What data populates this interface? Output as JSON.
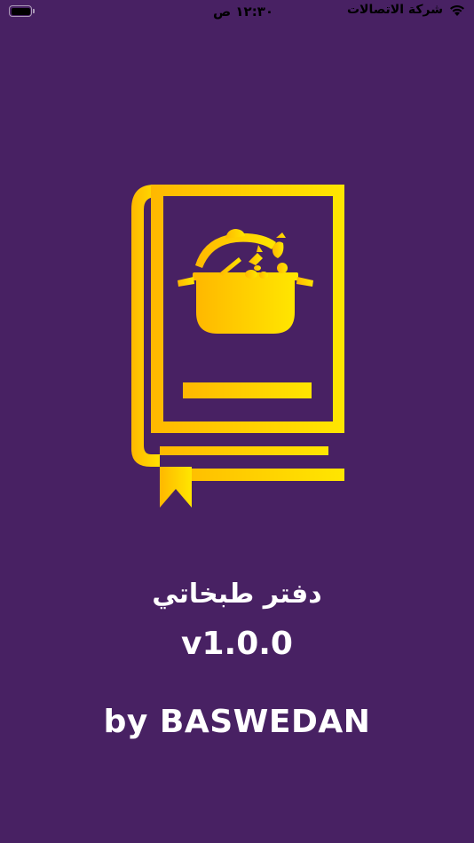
{
  "status_bar": {
    "time": "١٢:٣٠ ص",
    "carrier": "شركة الاتصالات",
    "battery_icon": "battery-icon",
    "wifi_icon": "wifi-icon"
  },
  "splash": {
    "logo_icon": "cookbook-pot-icon",
    "app_name": "دفتر طبخاتي",
    "version": "v1.0.0",
    "credit": "by BASWEDAN"
  },
  "colors": {
    "background": "#482163",
    "logo_gold_start": "#FFB800",
    "logo_gold_end": "#FFE600",
    "text": "#FFFFFF"
  }
}
